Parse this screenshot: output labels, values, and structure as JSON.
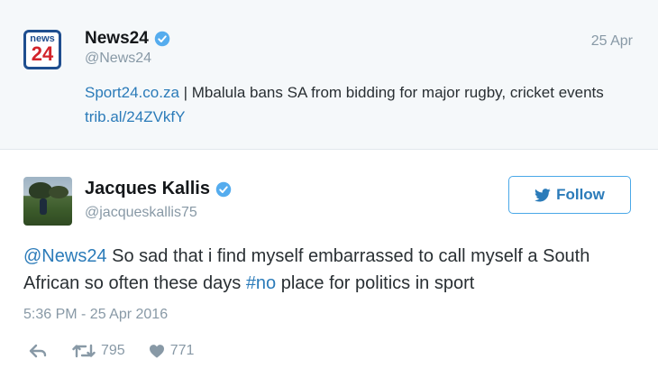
{
  "quoted_tweet": {
    "logo": {
      "line1": "news",
      "line2": "24"
    },
    "name": "News24",
    "verified": true,
    "handle": "@News24",
    "date": "25 Apr",
    "text_link": "Sport24.co.za",
    "text_body": " | Mbalula bans SA from bidding for major rugby, cricket events ",
    "text_url": "trib.al/24ZVkfY"
  },
  "tweet": {
    "author_name": "Jacques Kallis",
    "verified": true,
    "author_handle": "@jacqueskallis75",
    "follow_label": "Follow",
    "text_mention": "@News24",
    "text_part1": " So sad that i find myself embarrassed to call myself a South African so often these days ",
    "text_hashtag": "#no",
    "text_part2": " place for politics in sport",
    "timestamp": "5:36 PM - 25 Apr 2016",
    "retweet_count": "795",
    "like_count": "771"
  },
  "colors": {
    "link": "#2b7bb9",
    "verified": "#55acee",
    "muted": "#8899a6",
    "quoted_bg": "#f5f8fa"
  },
  "icons": [
    "verified-badge-icon",
    "twitter-bird-icon",
    "reply-icon",
    "retweet-icon",
    "heart-icon"
  ]
}
